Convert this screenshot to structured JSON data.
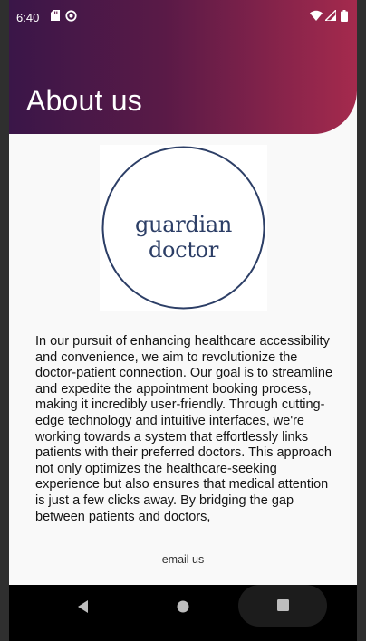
{
  "status_bar": {
    "time": "6:40",
    "left_icons": [
      "sd-card-icon",
      "sync-icon"
    ],
    "right_icons": [
      "wifi-icon",
      "signal-icon",
      "battery-icon"
    ]
  },
  "header": {
    "title": "About us",
    "gradient_colors": [
      "#3a1648",
      "#a52a4d"
    ]
  },
  "logo": {
    "text": "guardian doctor",
    "color": "#2c3e66"
  },
  "content": {
    "about_text": "In our pursuit of enhancing healthcare accessibility and convenience, we aim to revolutionize the doctor-patient connection. Our goal is to streamline and expedite the appointment booking process, making it incredibly user-friendly. Through cutting-edge technology and intuitive interfaces, we're working towards a system that effortlessly links patients with their preferred doctors. This approach not only optimizes the healthcare-seeking experience but also ensures that medical attention is just a few clicks away. By bridging the gap between patients and doctors,",
    "email_link": "email us"
  },
  "nav_bar": {
    "buttons": [
      "back-icon",
      "home-icon",
      "recents-icon"
    ]
  }
}
